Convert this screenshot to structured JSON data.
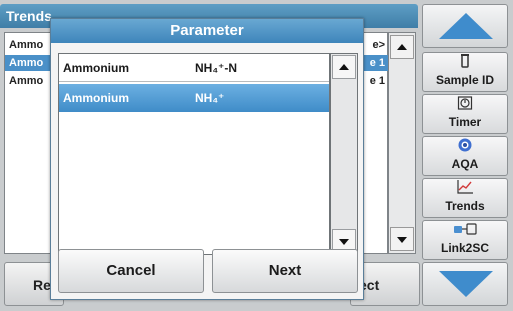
{
  "background_screen": {
    "title": "Trends",
    "rows": [
      {
        "name": "Ammo",
        "right": "e>"
      },
      {
        "name": "Ammo",
        "right": "e 1"
      },
      {
        "name": "Ammo",
        "right": "e 1"
      }
    ],
    "bottom_left_label": "Re",
    "bottom_right_label": "ect"
  },
  "sidebar": {
    "items": [
      {
        "label": "Sample ID",
        "icon": "vial-icon"
      },
      {
        "label": "Timer",
        "icon": "timer-icon"
      },
      {
        "label": "AQA",
        "icon": "aqa-icon"
      },
      {
        "label": "Trends",
        "icon": "trends-icon"
      },
      {
        "label": "Link2SC",
        "icon": "link2sc-icon"
      }
    ]
  },
  "dialog": {
    "title": "Parameter",
    "header": {
      "name": "Ammonium",
      "formula": "NH₄⁺-N"
    },
    "selected_row": {
      "name": "Ammonium",
      "formula": "NH₄⁺"
    },
    "cancel_label": "Cancel",
    "next_label": "Next"
  },
  "colors": {
    "accent_blue": "#3f8ccc",
    "title_blue": "#4f95c6"
  }
}
